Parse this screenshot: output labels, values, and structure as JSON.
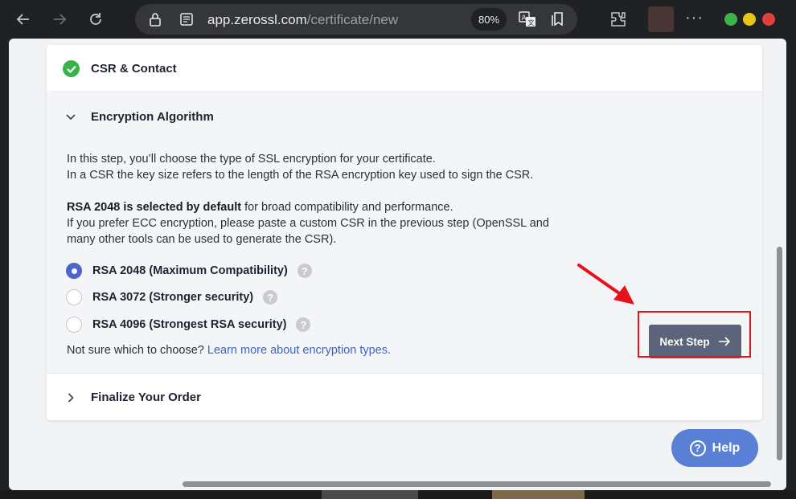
{
  "browser": {
    "url_host": "app.zerossl.com",
    "url_path": "/certificate/new",
    "zoom": "80%"
  },
  "steps": {
    "csr": {
      "title": "CSR & Contact"
    },
    "encryption": {
      "title": "Encryption Algorithm",
      "intro_line1": "In this step, you’ll choose the type of SSL encryption for your certificate.",
      "intro_line2": "In a CSR the key size refers to the length of the RSA encryption key used to sign the CSR.",
      "default_bold": "RSA 2048 is selected by default",
      "default_rest": " for broad compatibility and performance.",
      "ecc_line1": "If you prefer ECC encryption, please paste a custom CSR in the previous step (OpenSSL and",
      "ecc_line2": "many other tools can be used to generate the CSR).",
      "options": [
        {
          "label": "RSA 2048 (Maximum Compatibility)",
          "selected": true
        },
        {
          "label": "RSA 3072 (Stronger security)",
          "selected": false
        },
        {
          "label": "RSA 4096 (Strongest RSA security)",
          "selected": false
        }
      ],
      "help_prefix": "Not sure which to choose? ",
      "help_link": "Learn more about encryption types.",
      "next_label": "Next Step"
    },
    "finalize": {
      "title": "Finalize Your Order"
    }
  },
  "help_button": {
    "label": "Help"
  },
  "colors": {
    "accent": "#4d64c9",
    "success": "#38b24a",
    "link": "#3b64c4",
    "highlight": "#e8101a"
  }
}
